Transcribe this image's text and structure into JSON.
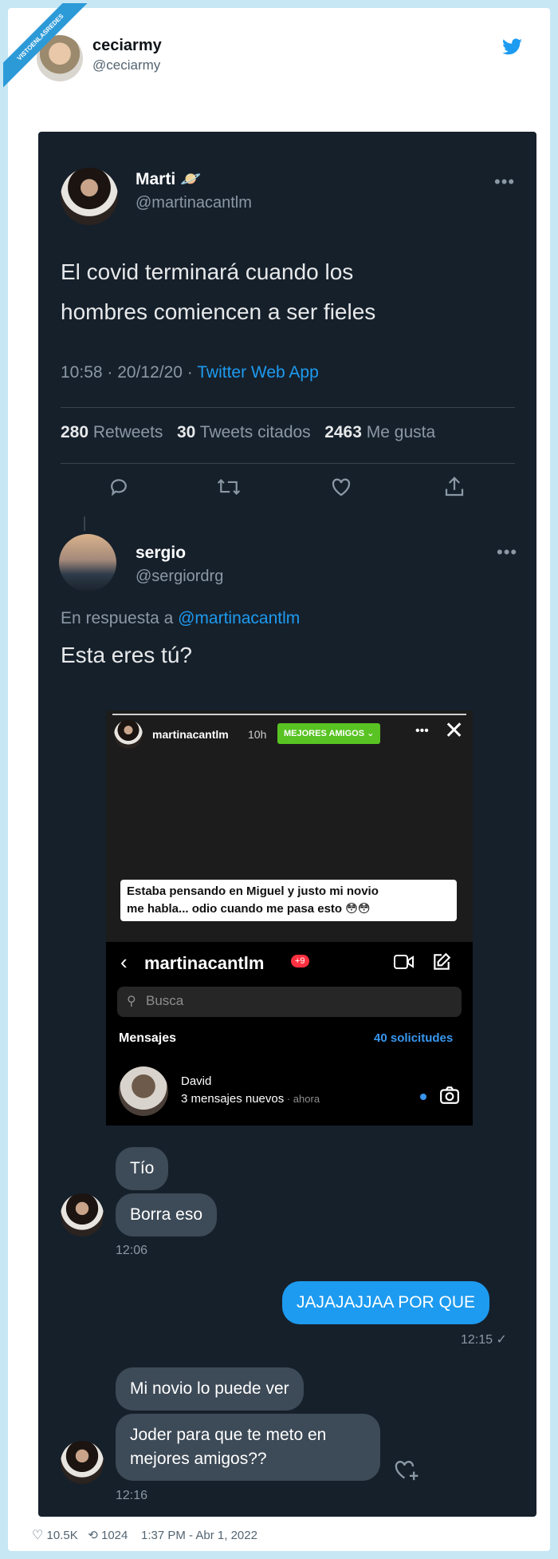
{
  "ribbon": "VISTOENLASREDES",
  "author": {
    "name": "ceciarmy",
    "handle": "@ceciarmy"
  },
  "tweet": {
    "name": "Marti",
    "handle": "@martinacantlm",
    "text_line1": "El covid terminará cuando los",
    "text_line2": "hombres comiencen a ser fieles",
    "time": "10:58 · 20/12/20 · ",
    "app": "Twitter Web App",
    "retweets_num": "280",
    "retweets_label": "Retweets",
    "quotes_num": "30",
    "quotes_label": "Tweets citados",
    "likes_num": "2463",
    "likes_label": "Me gusta"
  },
  "reply": {
    "name": "sergio",
    "handle": "@sergiordrg",
    "reply_to": "En respuesta a ",
    "reply_to_handle": "@martinacantlm",
    "text": "Esta eres tú?"
  },
  "story": {
    "user": "martinacantlm",
    "time": "10h",
    "badge": "MEJORES AMIGOS ⌄",
    "caption_line1": "Estaba pensando en Miguel y justo mi novio",
    "caption_line2": "me habla... odio cuando me pasa esto 😳😳",
    "dm_title": "martinacantlm",
    "dm_badge": "+9",
    "search_placeholder": "Busca",
    "messages_label": "Mensajes",
    "requests_label": "40 solicitudes",
    "contact_name": "David",
    "contact_status": "3 mensajes nuevos",
    "contact_time": " · ahora"
  },
  "chat": {
    "msg1": "Tío",
    "msg2": "Borra eso",
    "time1": "12:06",
    "msg3": "JAJAJAJJAA POR QUE",
    "time2": "12:15 ✓",
    "msg4": "Mi novio lo puede ver",
    "msg5_line1": "Joder para que te meto en",
    "msg5_line2": "mejores amigos??",
    "time3": "12:16"
  },
  "footer": {
    "likes": "10.5K",
    "retweets": "1024",
    "timestamp": "1:37 PM - Abr 1, 2022"
  },
  "colors": {
    "accent": "#1d9bf0",
    "dark_bg": "#16202b",
    "bubble_gray": "#3d4a57",
    "ig_green": "#58c322"
  }
}
